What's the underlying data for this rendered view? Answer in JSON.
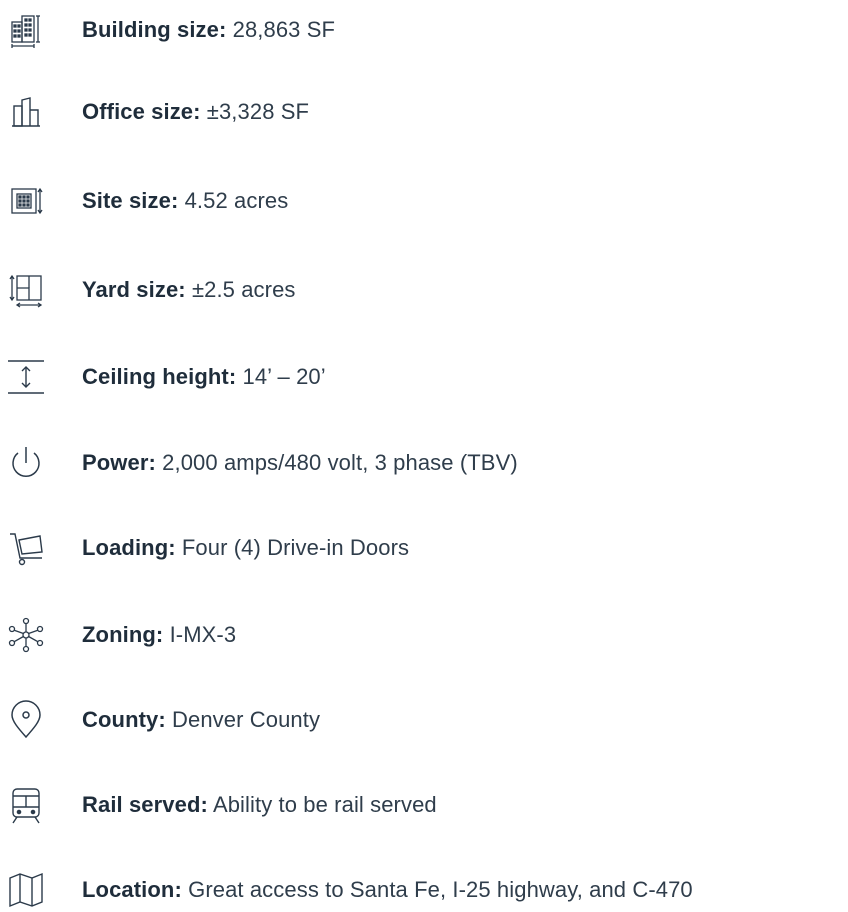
{
  "specs": [
    {
      "label": "Building size:",
      "value": "28,863 SF",
      "icon": "building-icon"
    },
    {
      "label": "Office size:",
      "value": "±3,328 SF",
      "icon": "office-icon"
    },
    {
      "label": "Site size:",
      "value": "4.52 acres",
      "icon": "site-size-icon"
    },
    {
      "label": "Yard size:",
      "value": "±2.5 acres",
      "icon": "yard-size-icon"
    },
    {
      "label": "Ceiling height:",
      "value": "14’ – 20’",
      "icon": "ceiling-height-icon"
    },
    {
      "label": "Power:",
      "value": "2,000 amps/480 volt, 3 phase (TBV)",
      "icon": "power-icon"
    },
    {
      "label": "Loading:",
      "value": "Four (4) Drive-in Doors",
      "icon": "loading-cart-icon"
    },
    {
      "label": "Zoning:",
      "value": "I-MX-3",
      "icon": "zoning-network-icon"
    },
    {
      "label": "County:",
      "value": "Denver County",
      "icon": "map-pin-icon"
    },
    {
      "label": "Rail served:",
      "value": "Ability to be rail served",
      "icon": "train-icon"
    },
    {
      "label": "Location:",
      "value": "Great access to Santa Fe, I-25 highway, and C-470",
      "icon": "map-icon"
    }
  ],
  "colors": {
    "icon_stroke": "#2b3a4a",
    "text": "#2b3a4a"
  }
}
